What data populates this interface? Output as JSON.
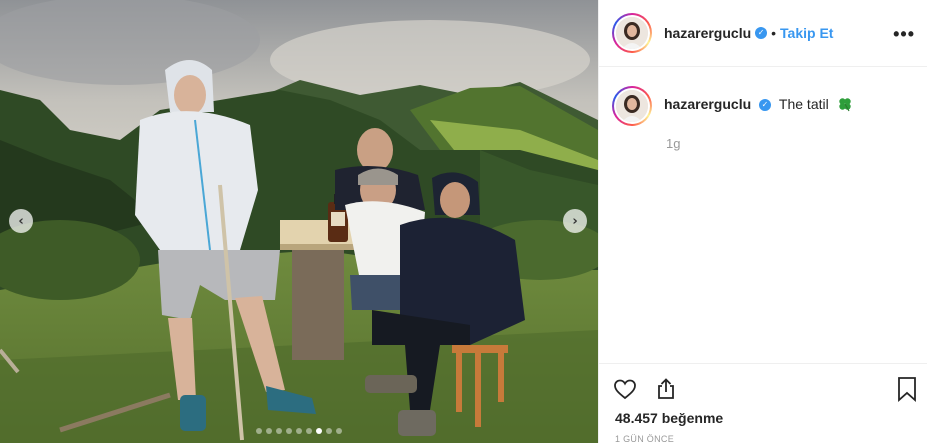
{
  "post": {
    "username": "hazarerguclu",
    "verified": true,
    "separator": "•",
    "follow_label": "Takip Et",
    "more_label": "•••",
    "caption": "The tatil",
    "caption_emoji": "four-leaf-clover-icon",
    "comment_time": "1g",
    "likes": "48.457 beğenme",
    "posted_ago": "1 GÜN ÖNCE"
  },
  "carousel": {
    "prev_label": "‹",
    "next_label": "›",
    "dot_count": 9,
    "active_dot": 6
  },
  "icons": {
    "like": "heart-icon",
    "share": "share-icon",
    "save": "bookmark-icon",
    "verified": "verified-badge-icon"
  },
  "colors": {
    "accent": "#3897f0",
    "text": "#262626",
    "muted": "#999999",
    "border": "#efefef"
  }
}
